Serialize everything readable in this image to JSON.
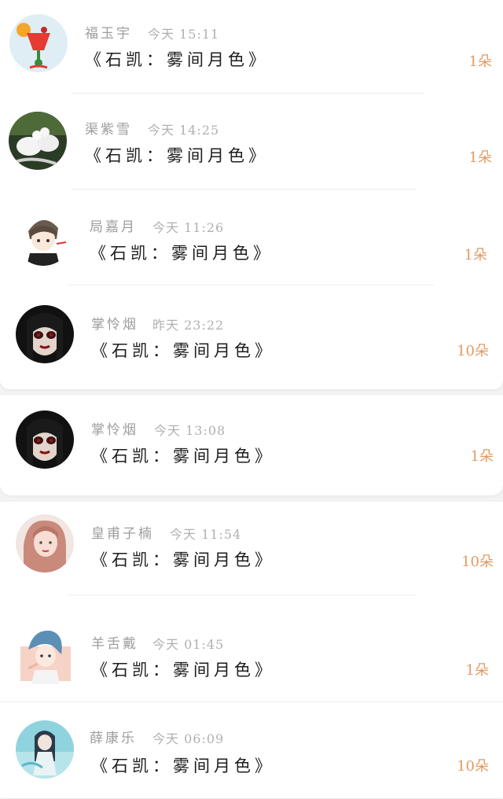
{
  "colors": {
    "accent": "#e39a62",
    "name": "#9d9d9d",
    "title": "#1d1d1d",
    "background": "#f3f3f3"
  },
  "gifts": [
    {
      "name": "福玉宇",
      "time": "今天 15:11",
      "title": "《石凯：雾间月色》",
      "count": "1朵",
      "avatar": "cocktail-avatar"
    },
    {
      "name": "渠紫雪",
      "time": "今天 14:25",
      "title": "《石凯：雾间月色》",
      "count": "1朵",
      "avatar": "doves-avatar"
    },
    {
      "name": "局嘉月",
      "time": "今天 11:26",
      "title": "《石凯：雾间月色》",
      "count": "1朵",
      "avatar": "anime-boy-avatar"
    },
    {
      "name": "掌怜烟",
      "time": "昨天 23:22",
      "title": "《石凯：雾间月色》",
      "count": "10朵",
      "avatar": "gothic-girl-avatar"
    },
    {
      "name": "掌怜烟",
      "time": "今天 13:08",
      "title": "《石凯：雾间月色》",
      "count": "1朵",
      "avatar": "gothic-girl-avatar"
    },
    {
      "name": "皇甫子楠",
      "time": "今天 11:54",
      "title": "《石凯：雾间月色》",
      "count": "10朵",
      "avatar": "pink-hair-girl-avatar"
    },
    {
      "name": "羊舌戴",
      "time": "今天 01:45",
      "title": "《石凯：雾间月色》",
      "count": "1朵",
      "avatar": "blue-hair-boy-avatar"
    },
    {
      "name": "薛康乐",
      "time": "今天 06:09",
      "title": "《石凯：雾间月色》",
      "count": "10朵",
      "avatar": "water-girl-avatar"
    }
  ]
}
